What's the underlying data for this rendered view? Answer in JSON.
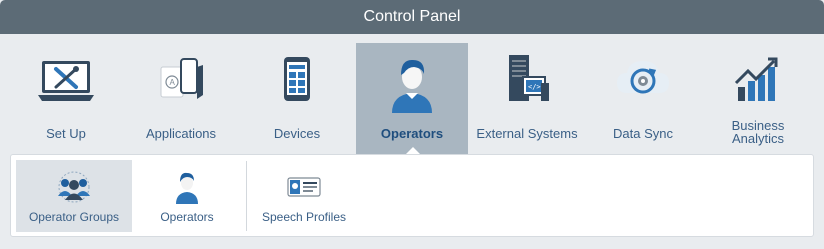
{
  "window": {
    "title": "Control Panel"
  },
  "nav": {
    "items": [
      {
        "label": "Set Up",
        "icon": "laptop-tools-icon",
        "active": false
      },
      {
        "label": "Applications",
        "icon": "applications-icon",
        "active": false
      },
      {
        "label": "Devices",
        "icon": "mobile-device-icon",
        "active": false
      },
      {
        "label": "Operators",
        "icon": "operator-icon",
        "active": true
      },
      {
        "label": "External Systems",
        "icon": "server-code-icon",
        "active": false
      },
      {
        "label": "Data Sync",
        "icon": "cloud-sync-icon",
        "active": false
      },
      {
        "label": "Business Analytics",
        "label_line1": "Business",
        "label_line2": "Analytics",
        "icon": "bar-chart-trend-icon",
        "active": false
      }
    ]
  },
  "subnav": {
    "items": [
      {
        "label": "Operator Groups",
        "icon": "operator-group-icon",
        "active": true
      },
      {
        "label": "Operators",
        "icon": "operator-icon",
        "active": false
      },
      {
        "label": "Speech Profiles",
        "icon": "speech-profile-card-icon",
        "active": false
      }
    ]
  },
  "colors": {
    "titlebar": "#5c6b76",
    "active_tab": "#a9b6c1",
    "label": "#3a5f86",
    "accent_blue": "#2f76b8"
  }
}
